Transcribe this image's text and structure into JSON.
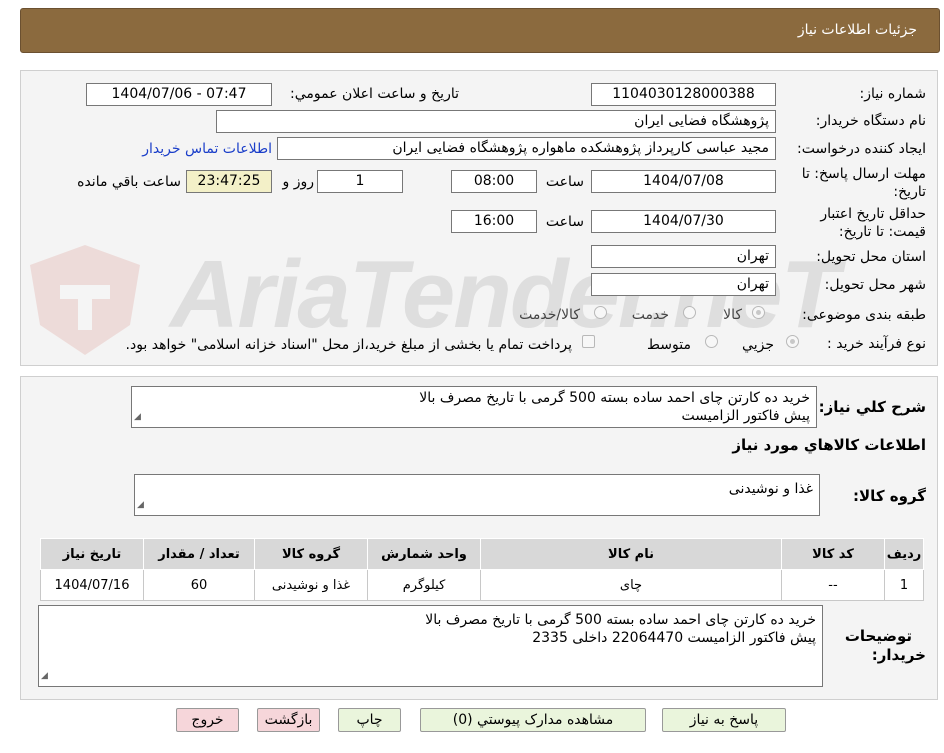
{
  "header": {
    "title": "جزئیات اطلاعات نیاز"
  },
  "watermark": {
    "text": "AriaTender.neT"
  },
  "fields": {
    "need_number_label": "شماره نیاز:",
    "need_number": "1104030128000388",
    "announce_label": "تاریخ و ساعت اعلان عمومي:",
    "announce_value": "1404/07/06 - 07:47",
    "buyer_org_label": "نام دستگاه خریدار:",
    "buyer_org": "پژوهشگاه فضایی ایران",
    "requester_label": "ایجاد کننده درخواست:",
    "requester": "مجید عباسی کارپرداز پژوهشکده ماهواره پژوهشگاه فضایی ایران",
    "contact_link": "اطلاعات تماس خریدار",
    "deadline_label_1": "مهلت ارسال پاسخ: تا",
    "deadline_label_2": "تاریخ:",
    "deadline_date": "1404/07/08",
    "time_label": "ساعت",
    "deadline_time": "08:00",
    "days_value": "1",
    "days_label": "روز و",
    "remaining_time": "23:47:25",
    "remaining_label": "ساعت باقي مانده",
    "validity_label_1": "حداقل تاریخ اعتبار",
    "validity_label_2": "قیمت: تا تاریخ:",
    "validity_date": "1404/07/30",
    "validity_time": "16:00",
    "province_label": "استان محل تحویل:",
    "province": "تهران",
    "city_label": "شهر محل تحویل:",
    "city": "تهران",
    "category_label": "طبقه بندی موضوعی:",
    "category_options": [
      "کالا",
      "خدمت",
      "کالا/خدمت"
    ],
    "process_label": "نوع فرآیند خرید :",
    "process_options": [
      "جزیي",
      "متوسط"
    ],
    "payment_note": "پرداخت تمام یا بخشی از مبلغ خرید،از محل \"اسناد خزانه اسلامی\" خواهد بود."
  },
  "summary": {
    "label": "شرح کلي نیاز:",
    "line1": "خرید ده کارتن چای احمد ساده بسته 500 گرمی با تاریخ مصرف بالا",
    "line2": "پیش فاکتور الزامیست"
  },
  "goods_section_title": "اطلاعات کالاهاي مورد نیاز",
  "goods_group": {
    "label": "گروه کالا:",
    "value": "غذا و نوشیدنی"
  },
  "table": {
    "headers": [
      "ردیف",
      "کد کالا",
      "نام کالا",
      "واحد شمارش",
      "گروه کالا",
      "تعداد / مقدار",
      "تاریخ نیاز"
    ],
    "rows": [
      [
        "1",
        "--",
        "چای",
        "کیلوگرم",
        "غذا و نوشیدنی",
        "60",
        "1404/07/16"
      ]
    ]
  },
  "buyer_notes": {
    "label_1": "توضیحات",
    "label_2": "خریدار:",
    "line1": "خرید ده کارتن چای احمد ساده بسته 500 گرمی با تاریخ مصرف بالا",
    "line2": "پیش فاکتور الزامیست 22064470 داخلی 2335"
  },
  "buttons": {
    "reply": "پاسخ به نیاز",
    "attachments": "مشاهده مدارک پیوستي (0)",
    "print": "چاپ",
    "back": "بازگشت",
    "exit": "خروج"
  }
}
